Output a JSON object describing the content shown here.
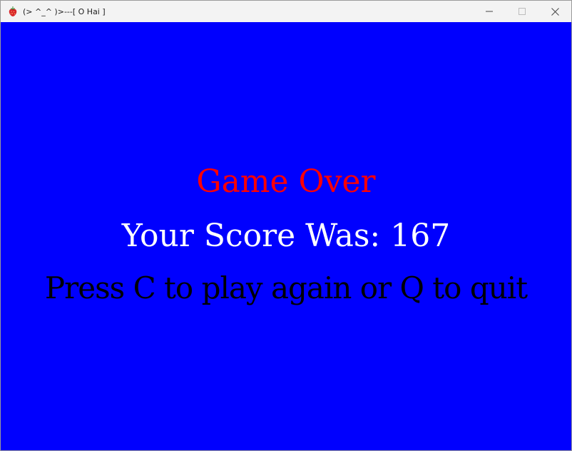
{
  "window": {
    "title": "(> ^_^ )>---[ O Hai ]",
    "icon": "strawberry-icon"
  },
  "controls": {
    "minimize_icon": "minimize-icon",
    "maximize_icon": "maximize-icon",
    "close_icon": "close-icon"
  },
  "game": {
    "background_color": "#0000FE",
    "title": "Game Over",
    "title_color": "#FF0000",
    "score_text": "Your Score Was: 167",
    "score_color": "#FFFFFF",
    "prompt_text": "Press C to play again or Q to quit",
    "prompt_color": "#000000"
  }
}
